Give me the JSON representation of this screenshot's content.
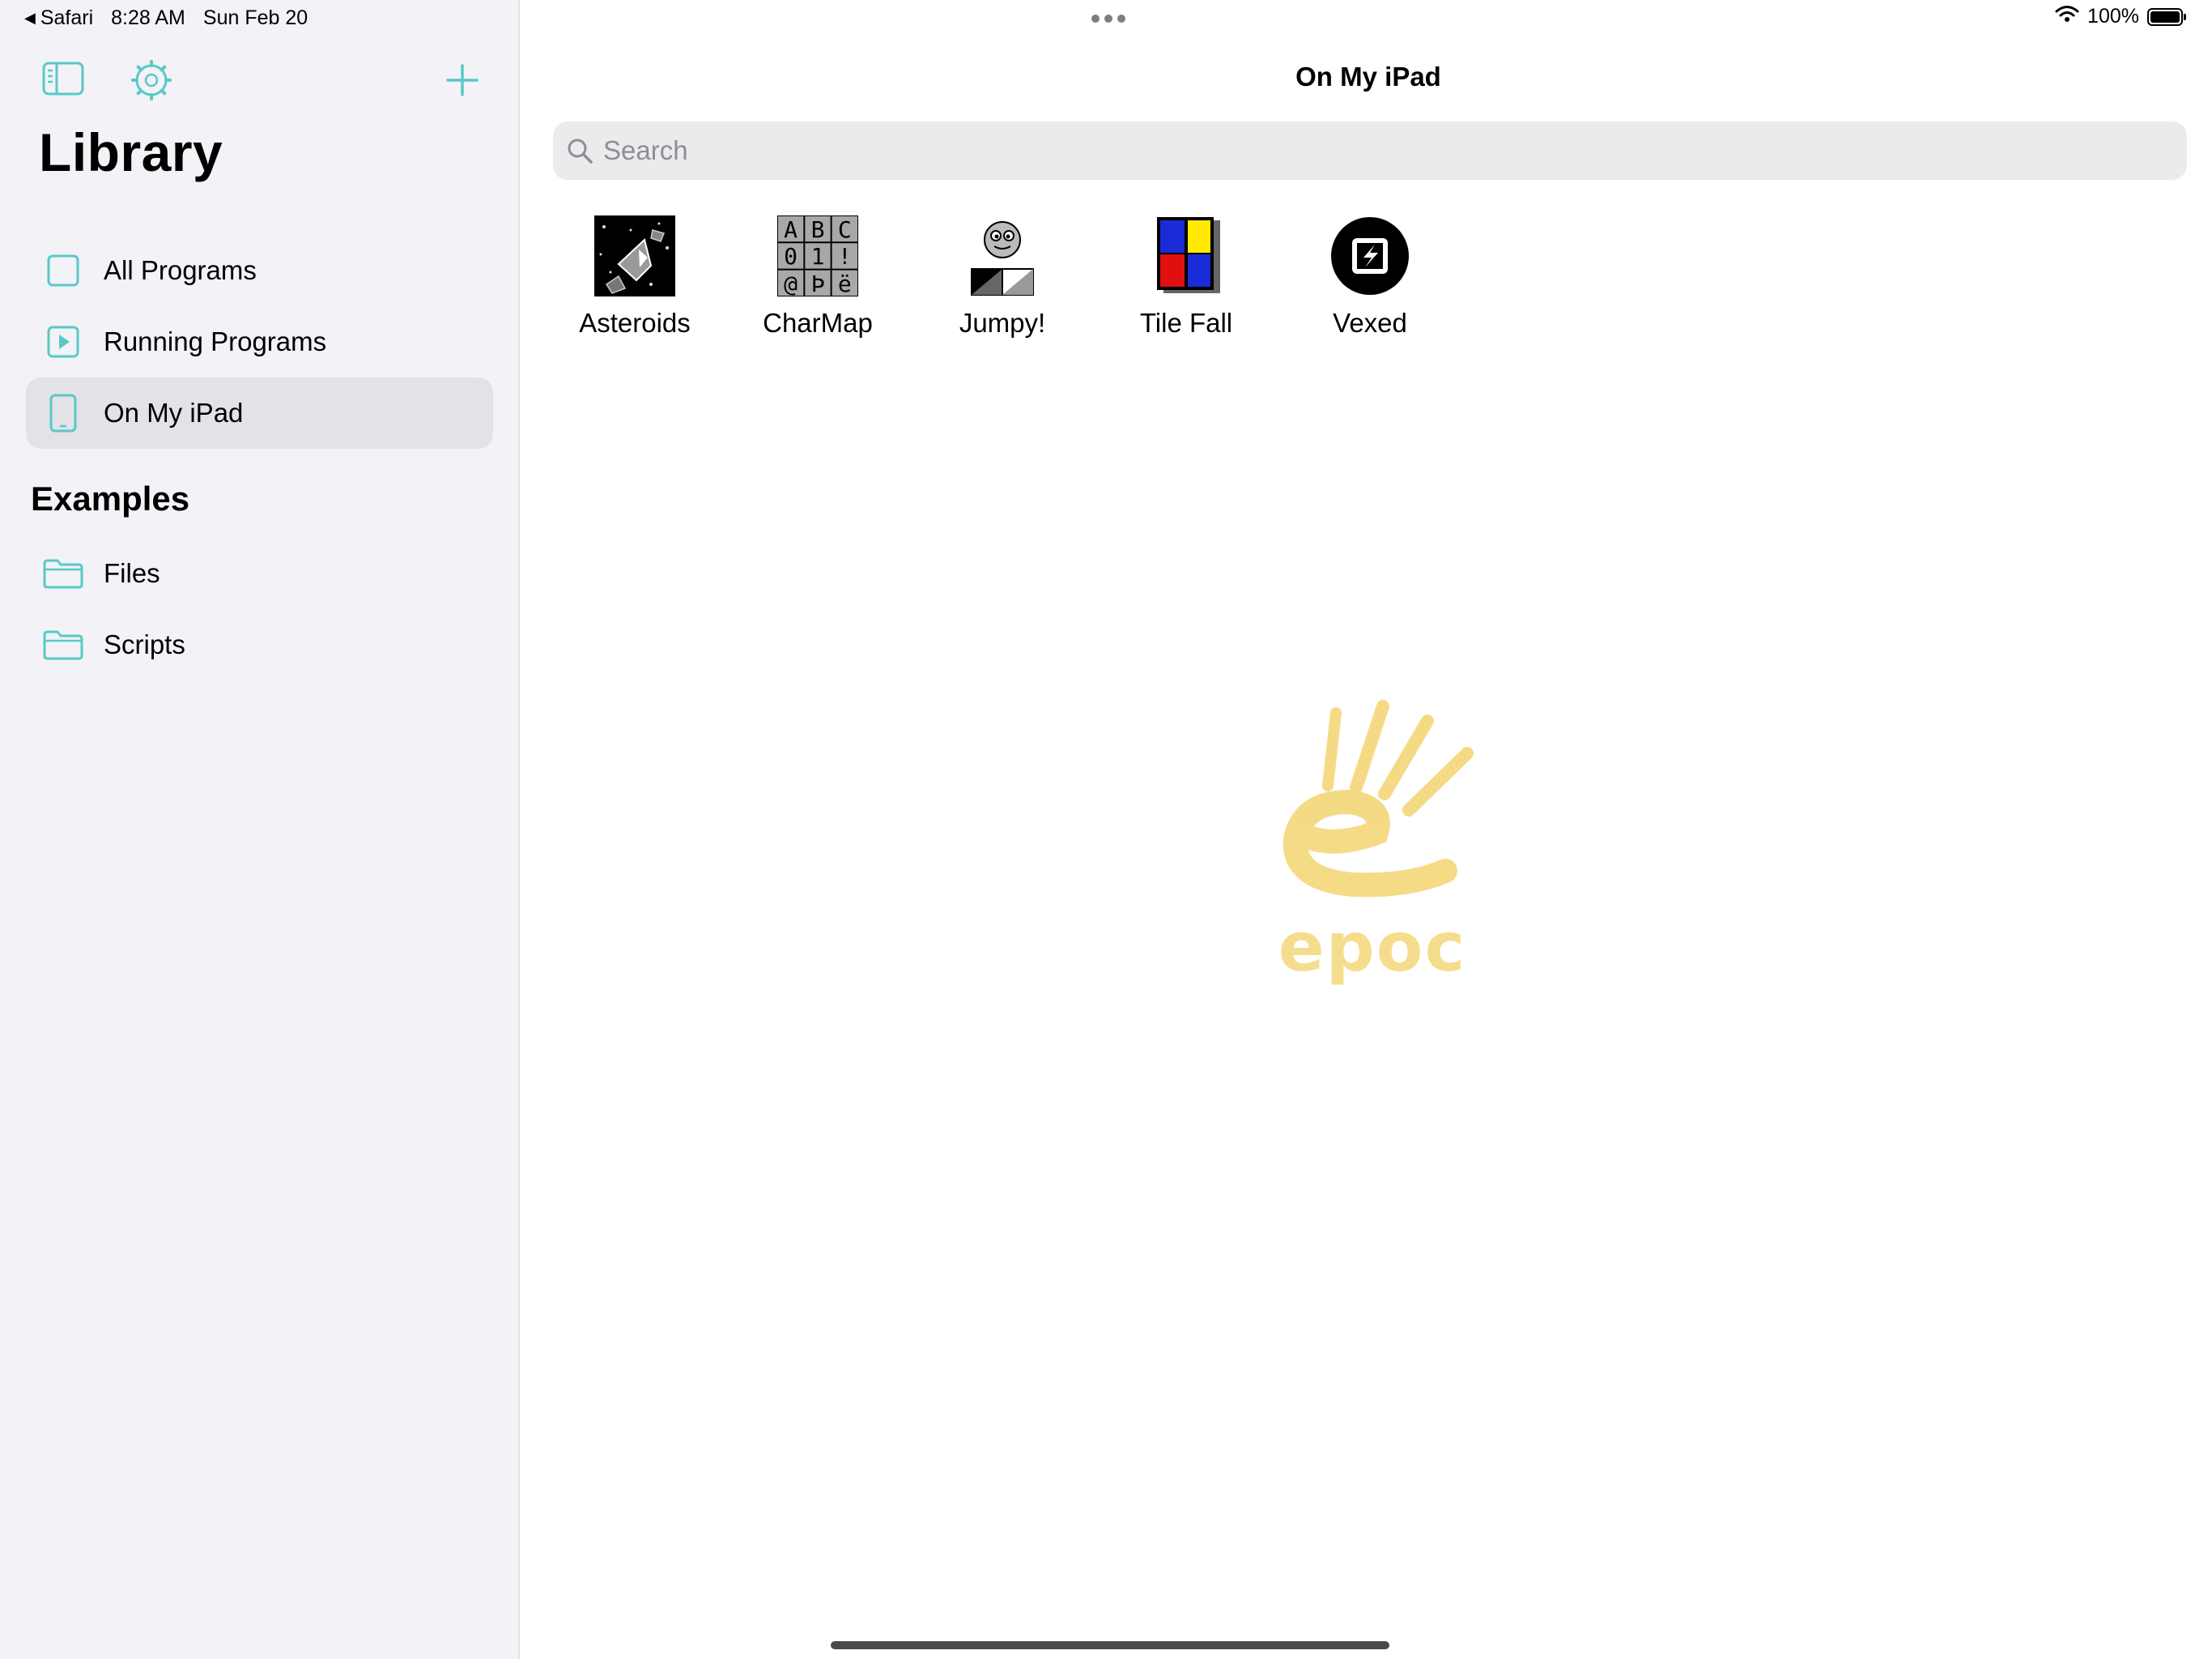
{
  "status_bar": {
    "back_app": "Safari",
    "time": "8:28 AM",
    "date": "Sun Feb 20",
    "battery": "100%"
  },
  "sidebar": {
    "title": "Library",
    "items": [
      {
        "label": "All Programs",
        "icon": "square-icon"
      },
      {
        "label": "Running Programs",
        "icon": "play-square-icon"
      },
      {
        "label": "On My iPad",
        "icon": "ipad-icon",
        "selected": true
      }
    ],
    "examples_header": "Examples",
    "examples": [
      {
        "label": "Files",
        "icon": "folder-icon"
      },
      {
        "label": "Scripts",
        "icon": "folder-icon"
      }
    ]
  },
  "main": {
    "title": "On My iPad",
    "search": {
      "placeholder": "Search",
      "value": ""
    },
    "programs": [
      {
        "label": "Asteroids"
      },
      {
        "label": "CharMap",
        "icon_chars": [
          "A",
          "B",
          "C",
          "0",
          "1",
          "!",
          "@",
          "Þ",
          "ë"
        ]
      },
      {
        "label": "Jumpy!"
      },
      {
        "label": "Tile Fall"
      },
      {
        "label": "Vexed"
      }
    ],
    "logo_text": "epoc"
  },
  "colors": {
    "accent": "#5ac8c8",
    "sidebar_bg": "#f2f2f7",
    "selected_bg": "#e2e2e7",
    "logo": "#f5d77a"
  }
}
